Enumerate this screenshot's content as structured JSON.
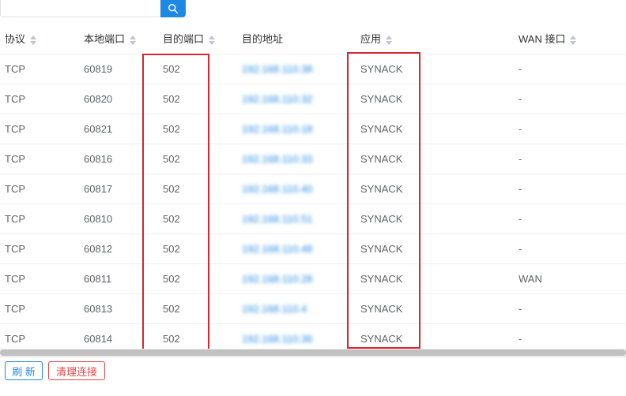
{
  "search": {
    "value": "",
    "placeholder": ""
  },
  "table": {
    "headers": {
      "protocol": "协议",
      "local_port": "本地端口",
      "dest_port": "目的端口",
      "dest_addr": "目的地址",
      "app": "应用",
      "wan": "WAN 接口"
    },
    "rows": [
      {
        "protocol": "TCP",
        "local_port": "60819",
        "dest_port": "502",
        "dest_addr": "192.168.110.38",
        "app": "SYNACK",
        "wan": "-"
      },
      {
        "protocol": "TCP",
        "local_port": "60820",
        "dest_port": "502",
        "dest_addr": "192.168.110.32",
        "app": "SYNACK",
        "wan": "-"
      },
      {
        "protocol": "TCP",
        "local_port": "60821",
        "dest_port": "502",
        "dest_addr": "192.168.110.18",
        "app": "SYNACK",
        "wan": "-"
      },
      {
        "protocol": "TCP",
        "local_port": "60816",
        "dest_port": "502",
        "dest_addr": "192.168.110.33",
        "app": "SYNACK",
        "wan": "-"
      },
      {
        "protocol": "TCP",
        "local_port": "60817",
        "dest_port": "502",
        "dest_addr": "192.168.110.40",
        "app": "SYNACK",
        "wan": "-"
      },
      {
        "protocol": "TCP",
        "local_port": "60810",
        "dest_port": "502",
        "dest_addr": "192.168.110.51",
        "app": "SYNACK",
        "wan": "-"
      },
      {
        "protocol": "TCP",
        "local_port": "60812",
        "dest_port": "502",
        "dest_addr": "192.168.110.48",
        "app": "SYNACK",
        "wan": "-"
      },
      {
        "protocol": "TCP",
        "local_port": "60811",
        "dest_port": "502",
        "dest_addr": "192.168.110.28",
        "app": "SYNACK",
        "wan": "WAN"
      },
      {
        "protocol": "TCP",
        "local_port": "60813",
        "dest_port": "502",
        "dest_addr": "192.168.110.4",
        "app": "SYNACK",
        "wan": "-"
      },
      {
        "protocol": "TCP",
        "local_port": "60814",
        "dest_port": "502",
        "dest_addr": "192.168.110.36",
        "app": "SYNACK",
        "wan": "-"
      }
    ]
  },
  "footer": {
    "refresh_label": "刷 新",
    "clear_label": "清理连接"
  },
  "colors": {
    "primary": "#1e88e5",
    "danger": "#e64545",
    "highlight": "#d9252e"
  }
}
